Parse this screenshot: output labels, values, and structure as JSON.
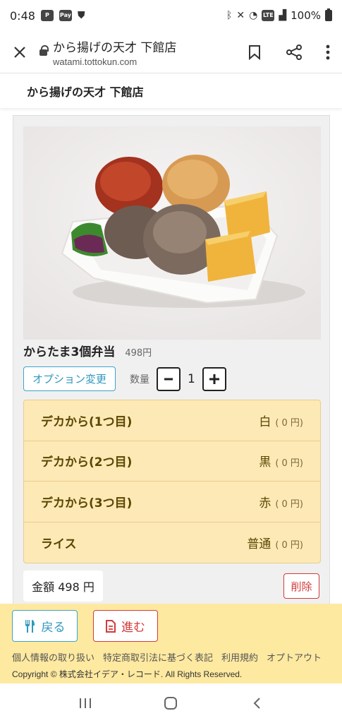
{
  "status_bar": {
    "time": "0:48",
    "battery": "100%",
    "icons": [
      "paypay-icon",
      "pay-icon",
      "shield-icon",
      "bluetooth-icon",
      "mute-icon",
      "wifi-icon",
      "volte-icon",
      "signal-icon",
      "battery-icon"
    ]
  },
  "browser": {
    "page_title": "から揚げの天才 下館店",
    "domain": "watami.tottokun.com"
  },
  "site_header": {
    "title": "から揚げの天才 下館店"
  },
  "product": {
    "name": "からたま3個弁当",
    "price": "498円",
    "option_button": "オプション変更",
    "quantity_label": "数量",
    "quantity": "1",
    "options": [
      {
        "name": "デカから(1つ目)",
        "value": "白",
        "price": "( 0 円)"
      },
      {
        "name": "デカから(2つ目)",
        "value": "黒",
        "price": "( 0 円)"
      },
      {
        "name": "デカから(3つ目)",
        "value": "赤",
        "price": "( 0 円)"
      },
      {
        "name": "ライス",
        "value": "普通",
        "price": "( 0 円)"
      }
    ],
    "total": "金額 498 円",
    "delete_button": "削除"
  },
  "footer": {
    "back_button": "戻る",
    "next_button": "進む",
    "links": [
      "個人情報の取り扱い",
      "特定商取引法に基づく表記",
      "利用規約",
      "オプトアウト"
    ],
    "copyright": "Copyright © 株式会社イデア・レコード. All Rights Reserved."
  },
  "colors": {
    "accent_blue": "#3ba5c9",
    "accent_red": "#d43a3a",
    "option_bg": "#fde9b6",
    "footer_bg": "#fde9a0"
  }
}
